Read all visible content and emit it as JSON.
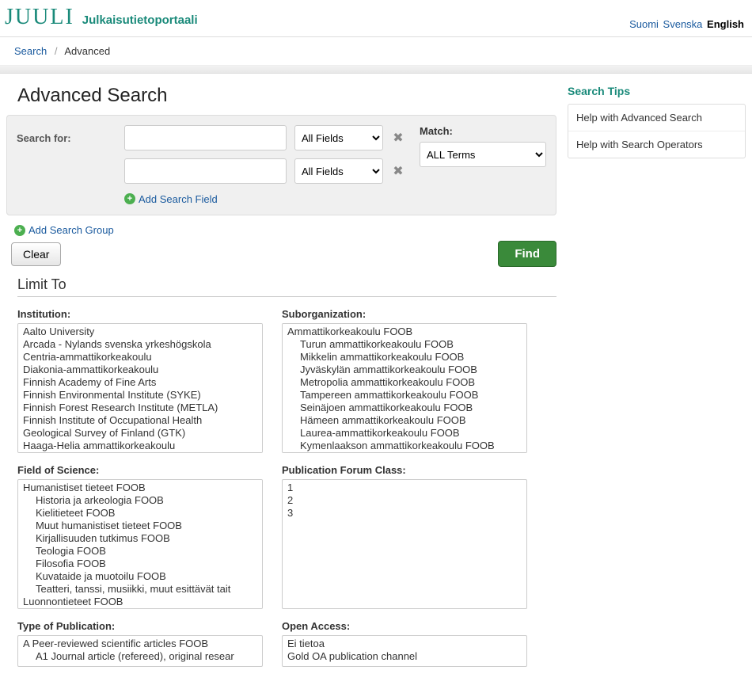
{
  "brand": {
    "logo": "JUULI",
    "subtitle": "Julkaisutietoportaali"
  },
  "lang": {
    "fi": "Suomi",
    "sv": "Svenska",
    "en": "English"
  },
  "breadcrumb": {
    "search": "Search",
    "advanced": "Advanced"
  },
  "title": "Advanced Search",
  "search": {
    "label": "Search for:",
    "field_select": "All Fields",
    "match_label": "Match:",
    "match_value": "ALL Terms",
    "add_field": "Add Search Field",
    "add_group": "Add Search Group",
    "clear": "Clear",
    "find": "Find"
  },
  "limit_title": "Limit To",
  "filters": {
    "institution_label": "Institution:",
    "institution_options": [
      "Aalto University",
      "Arcada - Nylands svenska yrkeshögskola",
      "Centria-ammattikorkeakoulu",
      "Diakonia-ammattikorkeakoulu",
      "Finnish Academy of Fine Arts",
      "Finnish Environmental Institute (SYKE)",
      "Finnish Forest Research Institute (METLA)",
      "Finnish Institute of Occupational Health",
      "Geological Survey of Finland (GTK)",
      "Haaga-Helia ammattikorkeakoulu"
    ],
    "suborg_label": "Suborganization:",
    "suborg_root": "Ammattikorkeakoulu FOOB",
    "suborg_children": [
      "Turun ammattikorkeakoulu FOOB",
      "Mikkelin ammattikorkeakoulu FOOB",
      "Jyväskylän ammattikorkeakoulu FOOB",
      "Metropolia ammattikorkeakoulu FOOB",
      "Tampereen ammattikorkeakoulu FOOB",
      "Seinäjoen ammattikorkeakoulu FOOB",
      "Hämeen ammattikorkeakoulu FOOB",
      "Laurea-ammattikorkeakoulu FOOB",
      "Kymenlaakson ammattikorkeakoulu FOOB"
    ],
    "field_label": "Field of Science:",
    "field_root": "Humanistiset tieteet FOOB",
    "field_children": [
      "Historia ja arkeologia FOOB",
      "Kielitieteet FOOB",
      "Muut humanistiset tieteet FOOB",
      "Kirjallisuuden tutkimus FOOB",
      "Teologia FOOB",
      "Filosofia FOOB",
      "Kuvataide ja muotoilu FOOB",
      "Teatteri, tanssi, musiikki, muut esittävät tait"
    ],
    "field_root2": "Luonnontieteet FOOB",
    "pubforum_label": "Publication Forum Class:",
    "pubforum_options": [
      "1",
      "2",
      "3"
    ],
    "pubtype_label": "Type of Publication:",
    "pubtype_root": "A Peer-reviewed scientific articles FOOB",
    "pubtype_child": "A1 Journal article (refereed), original resear",
    "openaccess_label": "Open Access:",
    "openaccess_options": [
      "Ei tietoa",
      "Gold OA publication channel"
    ]
  },
  "side": {
    "title": "Search Tips",
    "link1": "Help with Advanced Search",
    "link2": "Help with Search Operators"
  }
}
